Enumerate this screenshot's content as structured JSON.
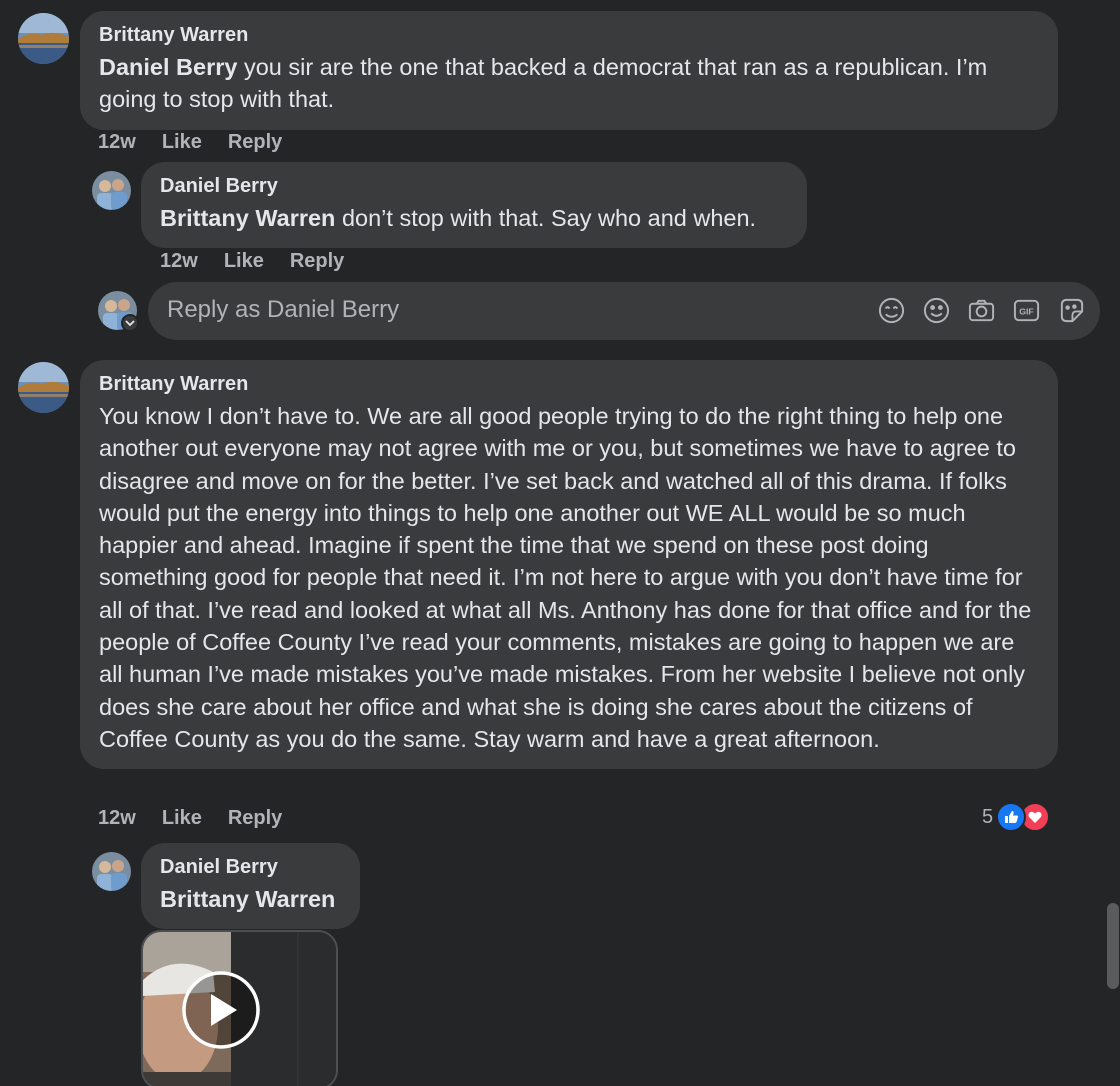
{
  "comments": [
    {
      "author": "Brittany Warren",
      "tag": "Daniel Berry",
      "text": " you sir are the one that backed a democrat that ran as a republican. I’m going to stop with that.",
      "time": "12w",
      "like": "Like",
      "reply": "Reply"
    },
    {
      "author": "Daniel Berry",
      "tag": "Brittany Warren",
      "text": " don’t stop with that. Say who and when.",
      "time": "12w",
      "like": "Like",
      "reply": "Reply"
    },
    {
      "author": "Brittany Warren",
      "text": "You know I don’t have to. We are all good people trying to do the right thing to help one another out everyone may not agree with me or you, but sometimes we have to agree to disagree and move on for the better. I’ve set back and watched all of this drama. If folks would put the energy into things to help one another out WE ALL would be so much happier and ahead. Imagine if spent the time that we spend on these post doing something good for people that need it. I’m not here to argue with you don’t have time for all of that. I’ve read and looked at what all Ms. Anthony has done for that office and for the people of Coffee County I’ve read your comments, mistakes are going to happen we are all human I’ve made mistakes you’ve made mistakes. From her website I believe not only does she care about her office and what she is doing she cares about the citizens of Coffee County as you do the same. Stay warm and have a great afternoon.",
      "time": "12w",
      "like": "Like",
      "reply": "Reply",
      "reaction_count": "5"
    },
    {
      "author": "Daniel Berry",
      "tag": "Brittany Warren"
    }
  ],
  "reply_box": {
    "placeholder": "Reply as Daniel Berry",
    "icons": [
      "avatar-sticker-icon",
      "emoji-icon",
      "camera-icon",
      "gif-icon",
      "sticker-icon"
    ]
  },
  "colors": {
    "background": "#242526",
    "bubble": "#3a3b3c",
    "like_blue": "#1877f2",
    "love_red": "#f33e58"
  }
}
